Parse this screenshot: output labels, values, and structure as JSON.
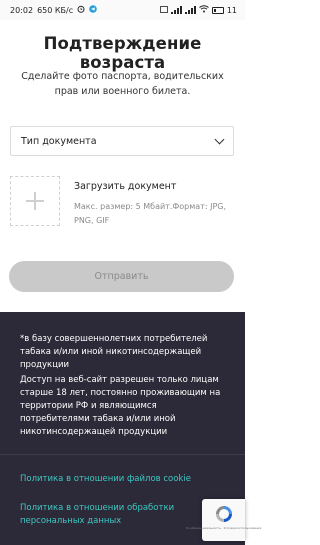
{
  "status_bar": {
    "time": "20:02",
    "speed": "650 КБ/с",
    "battery": "11"
  },
  "page": {
    "title": "Подтверждение возраста",
    "subtitle": "Сделайте фото паспорта, водительских прав или военного билета."
  },
  "form": {
    "document_type_placeholder": "Тип документа",
    "upload_label": "Загрузить документ",
    "upload_hint": "Макс. размер: 5 Мбайт.Формат: JPG, PNG, GIF",
    "submit_label": "Отправить"
  },
  "footer": {
    "note_1": "*в базу совершеннолетних потребителей табака и/или иной никотинсодержащей продукции",
    "note_2": "Доступ на веб-сайт разрешен только лицам старше 18 лет, постоянно проживающим на территории РФ и являющимся потребителями табака и/или иной никотинсодержащей продукции",
    "link_cookie": "Политика в отношении файлов cookie",
    "link_privacy": "Политика в отношении обработки персональных данных",
    "recaptcha_text": "Конфиденциальность - Условия использования"
  },
  "colors": {
    "footer_bg": "#2c2a38",
    "link": "#3ec7c2",
    "button_disabled": "#c9c9c9"
  },
  "icons": {
    "upload": "plus-icon",
    "dropdown": "chevron-down-icon",
    "recaptcha": "recaptcha-icon"
  }
}
